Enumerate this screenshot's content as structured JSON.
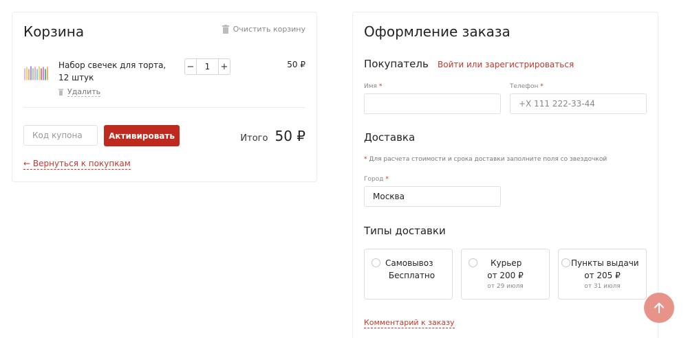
{
  "cart": {
    "title": "Корзина",
    "clear_label": "Очистить корзину",
    "items": [
      {
        "name": "Набор свечек для торта, 12 штук",
        "quantity": "1",
        "price": "50 ₽",
        "remove_label": "Удалить",
        "thumbnail_icon": "candles-icon"
      }
    ],
    "coupon_placeholder": "Код купона",
    "activate_label": "Активировать",
    "total_label": "Итого",
    "total_value": "50 ₽",
    "back_label": "← Вернуться к покупкам"
  },
  "checkout": {
    "title": "Оформление заказа",
    "buyer": {
      "heading": "Покупатель",
      "login_link": "Войти или зарегистрироваться",
      "name_label": "Имя",
      "phone_label": "Телефон",
      "name_value": "",
      "phone_placeholder": "+X 111 222-33-44"
    },
    "delivery": {
      "heading": "Доставка",
      "note": "Для расчета стоимости и срока доставки заполните поля со звездочкой",
      "city_label": "Город",
      "city_value": "Москва"
    },
    "delivery_types": {
      "heading": "Типы доставки",
      "options": [
        {
          "name": "Самовывоз",
          "price": "Бесплатно",
          "date": ""
        },
        {
          "name": "Курьер",
          "price": "от 200 ₽",
          "date": "от 29 июля"
        },
        {
          "name": "Пункты выдачи",
          "price": "от 205 ₽",
          "date": "от 31 июля"
        }
      ]
    },
    "comment_link": "Комментарий к заказу"
  },
  "required_marker": "*",
  "colors": {
    "accent": "#c0392b",
    "button": "#bf2a1f",
    "scroll_button": "#e8938a"
  },
  "icons": {
    "clear": "trash-icon",
    "remove": "trash-icon",
    "scroll_top": "arrow-up-icon"
  }
}
